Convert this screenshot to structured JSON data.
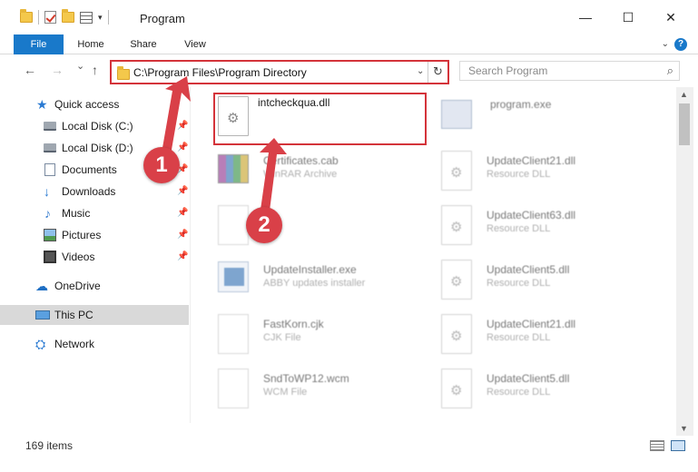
{
  "window": {
    "title": "Program",
    "controls": {
      "minimize": "—",
      "maximize": "☐",
      "close": "✕"
    }
  },
  "ribbon": {
    "tabs": [
      "File",
      "Home",
      "Share",
      "View"
    ],
    "help": "?"
  },
  "navigation": {
    "back": "←",
    "forward": "→",
    "recent": "⌄",
    "up": "↑",
    "address": "C:\\Program Files\\Program Directory",
    "search_placeholder": "Search Program"
  },
  "sidebar": {
    "items": [
      {
        "label": "Quick access",
        "icon": "star-icon"
      },
      {
        "label": "Local Disk (C:)",
        "icon": "disk-icon",
        "pinned": true
      },
      {
        "label": "Local Disk (D:)",
        "icon": "disk-icon",
        "pinned": true
      },
      {
        "label": "Documents",
        "icon": "documents-icon",
        "pinned": true
      },
      {
        "label": "Downloads",
        "icon": "downloads-icon",
        "pinned": true
      },
      {
        "label": "Music",
        "icon": "music-icon",
        "pinned": true
      },
      {
        "label": "Pictures",
        "icon": "pictures-icon",
        "pinned": true
      },
      {
        "label": "Videos",
        "icon": "videos-icon",
        "pinned": true
      },
      {
        "label": "OneDrive",
        "icon": "onedrive-icon"
      },
      {
        "label": "This PC",
        "icon": "this-pc-icon",
        "selected": true
      },
      {
        "label": "Network",
        "icon": "network-icon"
      }
    ]
  },
  "files": {
    "column1": [
      {
        "name": "intcheckqua.dll",
        "type": "",
        "icon": "dll-icon",
        "highlighted": true
      },
      {
        "name": "Certificates.cab",
        "type": "WinRAR Archive",
        "icon": "winrar-icon"
      },
      {
        "name": "cjk",
        "type": "File",
        "icon": "file-icon"
      },
      {
        "name": "UpdateInstaller.exe",
        "type": "ABBY updates installer",
        "icon": "exe-icon"
      },
      {
        "name": "FastKorn.cjk",
        "type": "CJK File",
        "icon": "file-icon"
      },
      {
        "name": "SndToWP12.wcm",
        "type": "WCM File",
        "icon": "file-icon"
      }
    ],
    "column2": [
      {
        "name": "program.exe",
        "type": "",
        "icon": "program-exe-icon"
      },
      {
        "name": "UpdateClient21.dll",
        "type": "Resource DLL",
        "icon": "dll-icon"
      },
      {
        "name": "UpdateClient63.dll",
        "type": "Resource DLL",
        "icon": "dll-icon"
      },
      {
        "name": "UpdateClient5.dll",
        "type": "Resource DLL",
        "icon": "dll-icon"
      },
      {
        "name": "UpdateClient21.dll",
        "type": "Resource DLL",
        "icon": "dll-icon"
      },
      {
        "name": "UpdateClient5.dll",
        "type": "Resource DLL",
        "icon": "dll-icon"
      }
    ]
  },
  "annotations": {
    "step1": "1",
    "step2": "2",
    "accent": "#d94048"
  },
  "status": {
    "item_count": "169 items"
  }
}
